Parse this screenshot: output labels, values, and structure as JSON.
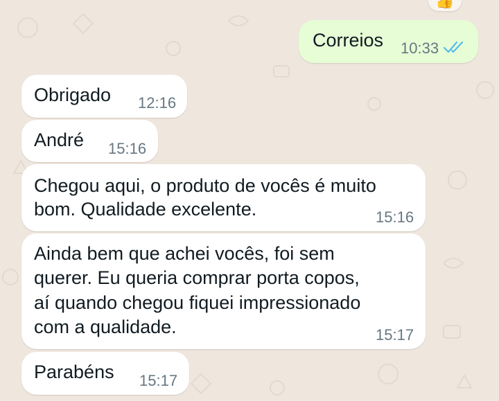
{
  "colors": {
    "wallpaper": "#efe7de",
    "incoming_bubble": "#ffffff",
    "outgoing_bubble": "#e7fdd6",
    "timestamp": "#667781",
    "read_ticks": "#53bdeb"
  },
  "reaction": {
    "emoji": "👍"
  },
  "messages": [
    {
      "direction": "outgoing",
      "text": "Correios",
      "time": "10:33",
      "status_icon": "double-check-read-icon"
    },
    {
      "direction": "incoming",
      "text": "Obrigado",
      "time": "12:16"
    },
    {
      "direction": "incoming",
      "text": "André",
      "time": "15:16"
    },
    {
      "direction": "incoming",
      "lines": [
        "Chegou aqui, o produto de vocês é muito",
        "bom. Qualidade excelente."
      ],
      "time": "15:16"
    },
    {
      "direction": "incoming",
      "lines": [
        "Ainda bem que achei vocês, foi sem",
        "querer. Eu queria comprar porta copos,",
        "aí quando chegou fiquei impressionado",
        "com a qualidade."
      ],
      "time": "15:17"
    },
    {
      "direction": "incoming",
      "text": "Parabéns",
      "time": "15:17"
    }
  ]
}
